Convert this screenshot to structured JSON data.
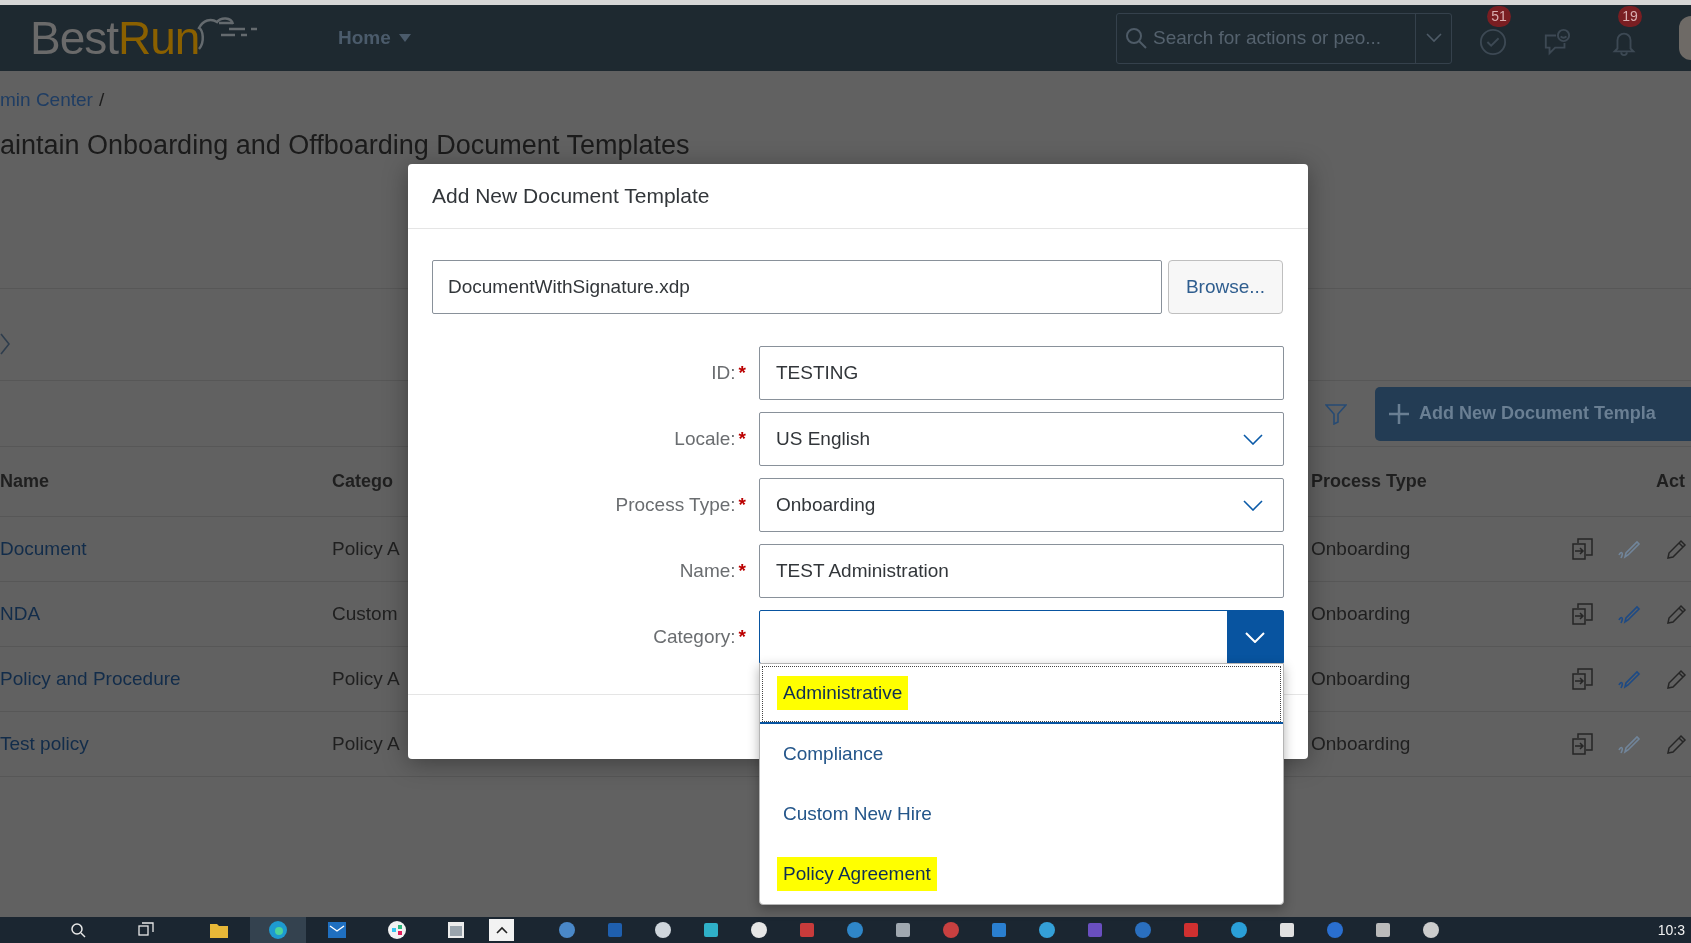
{
  "header": {
    "logo": {
      "text": "Best",
      "accent": "Run"
    },
    "home_menu": {
      "label": "Home"
    },
    "search": {
      "placeholder": "Search for actions or peo..."
    },
    "icons": [
      {
        "kind": "approvals",
        "badge": "51"
      },
      {
        "kind": "feedback"
      },
      {
        "kind": "notifications",
        "badge": "19"
      }
    ]
  },
  "breadcrumb": {
    "link": "min Center",
    "separator": "/"
  },
  "page_title": "aintain Onboarding and Offboarding Document Templates",
  "toolbar": {
    "add_button": {
      "label": "Add New Document Templa"
    }
  },
  "table": {
    "columns": [
      "Name",
      "Catego",
      "Process Type",
      "Act"
    ],
    "rows": [
      {
        "name": "Document",
        "category": "Policy A",
        "process_type": "Onboarding",
        "signature_enabled": false
      },
      {
        "name": "NDA",
        "category": "Custom",
        "process_type": "Onboarding",
        "signature_enabled": true
      },
      {
        "name": "Policy and Procedure",
        "category": "Policy A",
        "process_type": "Onboarding",
        "signature_enabled": true
      },
      {
        "name": "Test policy",
        "category": "Policy A",
        "process_type": "Onboarding",
        "signature_enabled": false
      }
    ]
  },
  "dialog": {
    "title": "Add New Document Template",
    "file_field": {
      "value": "DocumentWithSignature.xdp"
    },
    "browse_button": {
      "label": "Browse..."
    },
    "fields": [
      {
        "label": "ID:",
        "required_mark": "*",
        "kind": "text",
        "value": "TESTING"
      },
      {
        "label": "Locale:",
        "required_mark": "*",
        "kind": "select",
        "value": "US English",
        "open": false
      },
      {
        "label": "Process Type:",
        "required_mark": "*",
        "kind": "select",
        "value": "Onboarding",
        "open": false
      },
      {
        "label": "Name:",
        "required_mark": "*",
        "kind": "text",
        "value": "TEST Administration"
      },
      {
        "label": "Category:",
        "required_mark": "*",
        "kind": "select",
        "open": true
      }
    ],
    "category_options": [
      {
        "label": "Administrative",
        "selected": true,
        "highlighted": true
      },
      {
        "label": "Compliance",
        "selected": false,
        "highlighted": false
      },
      {
        "label": "Custom New Hire",
        "selected": false,
        "highlighted": false
      },
      {
        "label": "Policy Agreement",
        "selected": false,
        "highlighted": true
      }
    ]
  },
  "taskbar": {
    "clock": "10:3"
  }
}
